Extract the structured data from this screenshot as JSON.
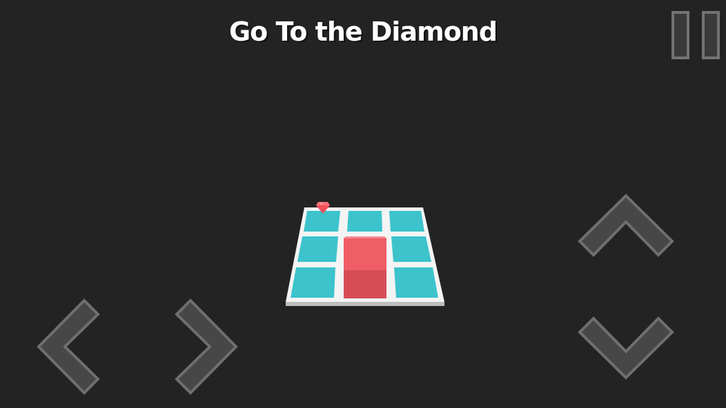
{
  "game": {
    "title": "Go To the Diamond"
  },
  "colors": {
    "background": "#232323",
    "board": "#f4f4f4",
    "tile": "#3cc3cb",
    "player_cube": "#ee5a64",
    "diamond": "#f04e5a",
    "control": "#4a4a4a",
    "control_outline": "#6f6f6f",
    "title_text": "#ffffff"
  },
  "board": {
    "rows": 3,
    "cols": 3,
    "player_cell": [
      1,
      1
    ],
    "diamond_cell": [
      0,
      0
    ]
  },
  "controls": {
    "pause": "pause-icon",
    "left": "chevron-left-icon",
    "right": "chevron-right-icon",
    "up": "chevron-up-icon",
    "down": "chevron-down-icon"
  }
}
